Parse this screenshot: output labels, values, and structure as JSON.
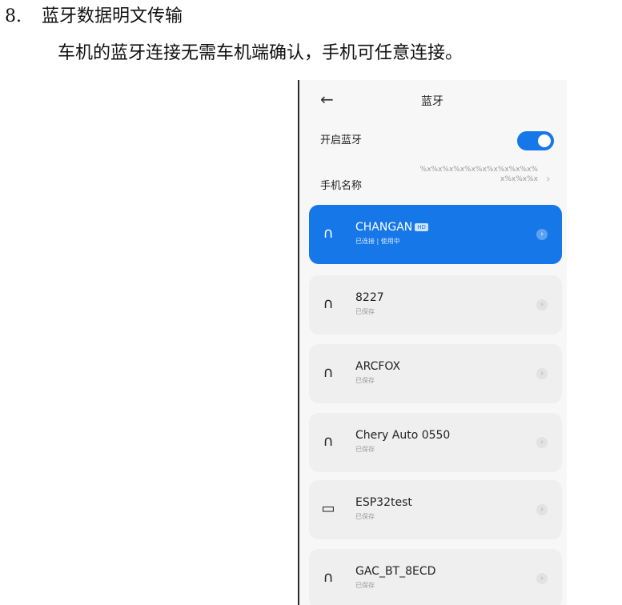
{
  "doc": {
    "heading_number": "8.",
    "heading_text": "蓝牙数据明文传输",
    "paragraph": "车机的蓝牙连接无需车机端确认，手机可任意连接。"
  },
  "phone": {
    "back_icon": "←",
    "title": "蓝牙",
    "bluetooth_label": "开启蓝牙",
    "bluetooth_on": true,
    "phone_name_label": "手机名称",
    "phone_name_value": "%x%x%x%x%x%x%x%x%x%x%x%x%x%x",
    "chevron": "›",
    "devices": [
      {
        "name": "CHANGAN",
        "tag": "HD",
        "status": "已连接 | 使用中",
        "icon": "headphones-icon",
        "active": true
      },
      {
        "name": "8227",
        "tag": "",
        "status": "已保存",
        "icon": "headphones-icon",
        "active": false
      },
      {
        "name": "ARCFOX",
        "tag": "",
        "status": "已保存",
        "icon": "headphones-icon",
        "active": false
      },
      {
        "name": "Chery Auto 0550",
        "tag": "",
        "status": "已保存",
        "icon": "headphones-icon",
        "active": false
      },
      {
        "name": "ESP32test",
        "tag": "",
        "status": "已保存",
        "icon": "laptop-icon",
        "active": false
      },
      {
        "name": "GAC_BT_8ECD",
        "tag": "",
        "status": "已保存",
        "icon": "headphones-icon",
        "active": false
      }
    ],
    "accent_color": "#1677e8"
  }
}
